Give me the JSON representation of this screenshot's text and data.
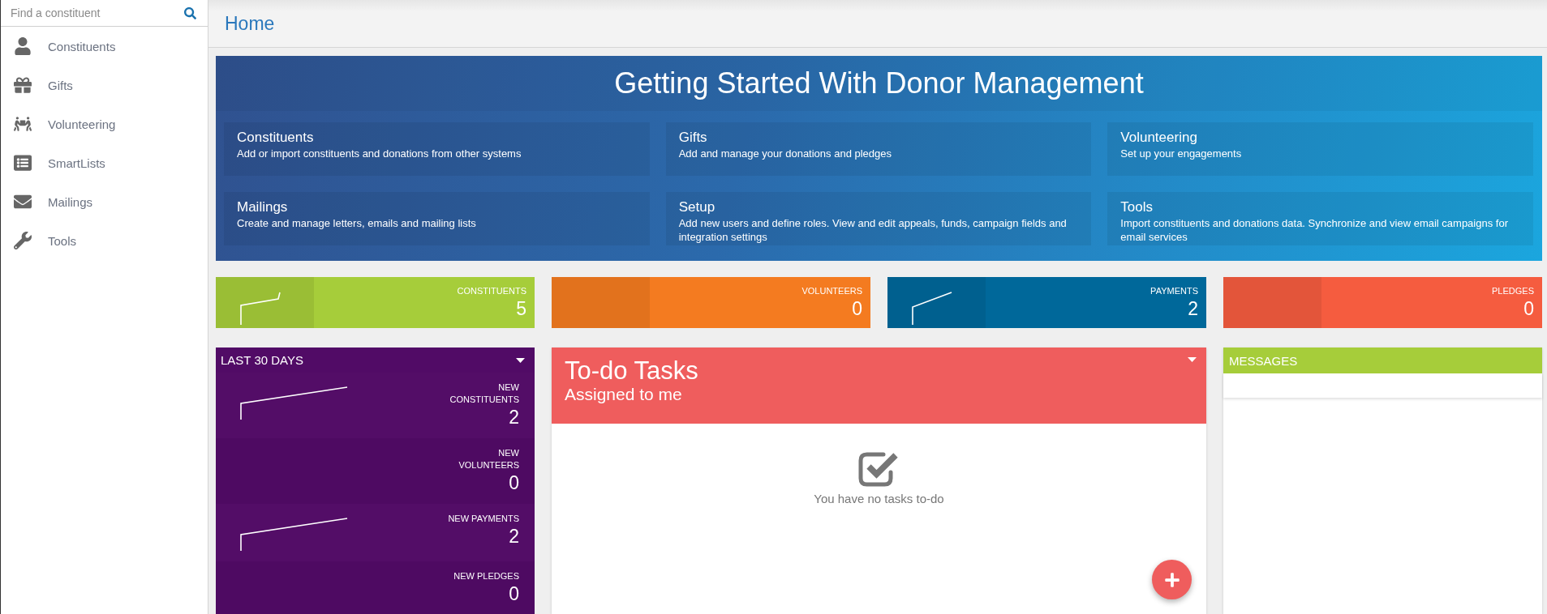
{
  "search": {
    "placeholder": "Find a constituent"
  },
  "sidebar": {
    "items": [
      {
        "label": "Constituents"
      },
      {
        "label": "Gifts"
      },
      {
        "label": "Volunteering"
      },
      {
        "label": "SmartLists"
      },
      {
        "label": "Mailings"
      },
      {
        "label": "Tools"
      }
    ]
  },
  "header": {
    "title": "Home"
  },
  "getting_started": {
    "title": "Getting Started With Donor Management",
    "cards": [
      {
        "title": "Constituents",
        "description": "Add or import constituents and donations from other systems"
      },
      {
        "title": "Gifts",
        "description": "Add and manage your donations and pledges"
      },
      {
        "title": "Volunteering",
        "description": "Set up your engagements"
      },
      {
        "title": "Mailings",
        "description": "Create and manage letters, emails and mailing lists"
      },
      {
        "title": "Setup",
        "description": "Add new users and define roles. View and edit appeals, funds, campaign fields and integration settings"
      },
      {
        "title": "Tools",
        "description": "Import constituents and donations data. Synchronize and view email campaigns for email services"
      }
    ]
  },
  "stat_tiles": [
    {
      "label": "CONSTITUENTS",
      "value": "5",
      "color": "#a6cd3a",
      "sparkline": true
    },
    {
      "label": "VOLUNTEERS",
      "value": "0",
      "color": "#f47b20",
      "sparkline": false
    },
    {
      "label": "PAYMENTS",
      "value": "2",
      "color": "#00689a",
      "sparkline": true
    },
    {
      "label": "PLEDGES",
      "value": "0",
      "color": "#f55c3f",
      "sparkline": false
    }
  ],
  "last_30_days": {
    "title": "LAST 30 DAYS",
    "stats": [
      {
        "label": "NEW CONSTITUENTS",
        "value": "2",
        "sparkline": true
      },
      {
        "label": "NEW VOLUNTEERS",
        "value": "0",
        "sparkline": false
      },
      {
        "label": "NEW PAYMENTS",
        "value": "2",
        "sparkline": true
      },
      {
        "label": "NEW PLEDGES",
        "value": "0",
        "sparkline": false
      }
    ]
  },
  "todo": {
    "title": "To-do Tasks",
    "subtitle": "Assigned to me",
    "empty_message": "You have no tasks to-do"
  },
  "messages": {
    "title": "MESSAGES"
  }
}
